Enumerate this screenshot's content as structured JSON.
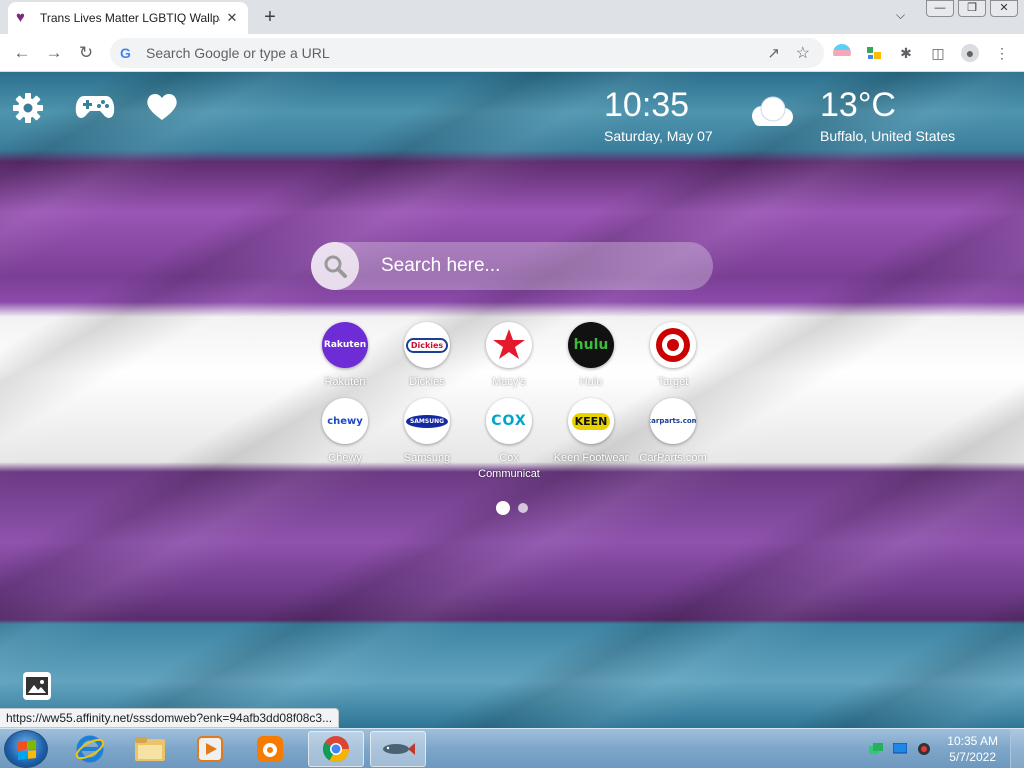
{
  "browser": {
    "tab_title": "Trans Lives Matter LGBTIQ Wallpa",
    "tab_close": "✕",
    "new_tab": "+",
    "omnibox_placeholder": "Search Google or type a URL"
  },
  "page": {
    "clock": {
      "time": "10:35",
      "date": "Saturday, May 07"
    },
    "weather": {
      "temp": "13°C",
      "location": "Buffalo, United States",
      "icon": "cloud-icon"
    },
    "search": {
      "placeholder": "Search here..."
    },
    "tiles": [
      {
        "label": "Rakuten"
      },
      {
        "label": "Dickies"
      },
      {
        "label": "Macy's"
      },
      {
        "label": "Hulu"
      },
      {
        "label": "Target"
      },
      {
        "label": "Chewy"
      },
      {
        "label": "Samsung"
      },
      {
        "label": "Cox Communicat"
      },
      {
        "label": "Keen Footwear"
      },
      {
        "label": "CarParts.com"
      }
    ],
    "tile_logos": {
      "rakuten": "Rakuten",
      "dickies": "Dickies",
      "hulu": "hulu",
      "chewy": "chewy",
      "samsung": "SAMSUNG",
      "cox": "COX",
      "keen": "KEEN",
      "carparts": "carparts.com"
    },
    "pagination": {
      "pages": 2,
      "current": 1
    }
  },
  "status_url": "https://ww55.affinity.net/sssdomweb?enk=94afb3dd08f08c3...",
  "taskbar": {
    "time": "10:35 AM",
    "date": "5/7/2022"
  },
  "colors": {
    "trans_blue": "#5bcefa",
    "trans_pink": "#f5a9b8",
    "flag_purple": "#8c4bab",
    "flag_teal": "#3d84a3"
  }
}
